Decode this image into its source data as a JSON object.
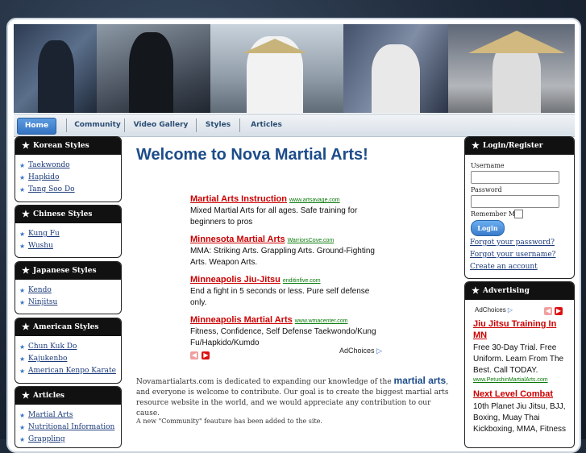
{
  "nav": {
    "items": [
      "Home",
      "Community",
      "Video Gallery",
      "Styles",
      "Articles"
    ]
  },
  "sidebar_left": [
    {
      "title": "Korean Styles",
      "items": [
        "Taekwondo",
        "Hapkido",
        "Tang Soo Do"
      ]
    },
    {
      "title": "Chinese Styles",
      "items": [
        "Kung Fu",
        "Wushu"
      ]
    },
    {
      "title": "Japanese Styles",
      "items": [
        "Kendo",
        "Ninjitsu"
      ]
    },
    {
      "title": "American Styles",
      "items": [
        "Chun Kuk Do",
        "Kajukenbo",
        "American Kenpo Karate"
      ]
    },
    {
      "title": "Articles",
      "items": [
        "Martial Arts",
        "Nutritional Information",
        "Grappling"
      ]
    }
  ],
  "main": {
    "title": "Welcome to Nova Martial Arts!",
    "ads": [
      {
        "title": "Martial Arts Instruction",
        "url": "www.artsavage.com",
        "desc": "Mixed Martial Arts for all ages. Safe training for beginners to pros"
      },
      {
        "title": "Minnesota Martial Arts",
        "url": "WarriorsCove.com",
        "desc": "MMA: Striking Arts. Grappling Arts. Ground-Fighting Arts. Weapon Arts."
      },
      {
        "title": "Minneapolis Jiu-Jitsu",
        "url": "enditinfive.com",
        "desc": "End a fight in 5 seconds or less. Pure self defense only."
      },
      {
        "title": "Minneapolis Martial Arts",
        "url": "www.wmacenter.com",
        "desc": "Fitness, Confidence, Self Defense Taekwondo/Kung Fu/Hapkido/Kumdo"
      }
    ],
    "adchoices": "AdChoices",
    "intro_pre": "Novamartialarts.com is dedicated to expanding our knowledge of the",
    "intro_big": "martial arts",
    "intro_post": ", and everyone is welcome to contribute. Our goal is to create the biggest martial arts resource website in the world, and we would appreciate any contribution to our cause.",
    "notice": "A new \"Community\" feauture has been added to the site."
  },
  "login": {
    "title": "Login/Register",
    "username_label": "Username",
    "password_label": "Password",
    "remember_label": "Remember Me",
    "login_button": "Login",
    "forgot_password": "Forgot your password?",
    "forgot_username": "Forgot your username?",
    "create_account": "Create an account"
  },
  "advertising": {
    "title": "Advertising",
    "adchoices": "AdChoices",
    "ads": [
      {
        "title": "Jiu Jitsu Training In MN",
        "desc": "Free 30-Day Trial. Free Uniform. Learn From The Best. Call TODAY.",
        "url": "www.PetushinMartialArts.com"
      },
      {
        "title": "Next Level Combat",
        "desc": "10th Planet Jiu Jitsu, BJJ, Boxing, Muay Thai Kickboxing, MMA, Fitness",
        "url": ""
      }
    ]
  },
  "colors": {
    "accent": "#1c4c8a",
    "ad_title": "#cc0000",
    "ad_url": "#0a7a0a",
    "box_header": "#111111"
  }
}
